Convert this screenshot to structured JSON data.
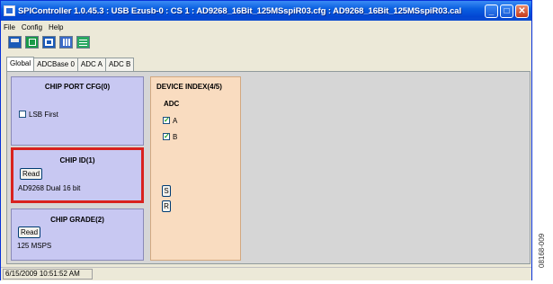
{
  "window": {
    "title": "SPIController 1.0.45.3 : USB Ezusb-0 : CS 1 : AD9268_16Bit_125MSspiR03.cfg : AD9268_16Bit_125MSspiR03.cal",
    "minimize_label": "_",
    "maximize_label": "□",
    "close_label": "✕"
  },
  "menu": {
    "items": [
      "File",
      "Config",
      "Help"
    ]
  },
  "toolbar": {
    "buttons": [
      "save-icon",
      "grid-icon",
      "table-icon",
      "chip-icon",
      "settings-icon"
    ]
  },
  "tabs": [
    "Global",
    "ADCBase 0",
    "ADC A",
    "ADC B"
  ],
  "chip_port_cfg": {
    "title": "CHIP PORT CFG(0)",
    "lsb_first_label": "LSB First",
    "lsb_first_checked": false
  },
  "chip_id": {
    "title": "CHIP ID(1)",
    "read_label": "Read",
    "value": "AD9268 Dual 16 bit"
  },
  "chip_grade": {
    "title": "CHIP GRADE(2)",
    "read_label": "Read",
    "value": "125 MSPS"
  },
  "device_index": {
    "title": "DEVICE INDEX(4/5)",
    "adc_label": "ADC",
    "channel_a_label": "A",
    "channel_a_checked": true,
    "channel_b_label": "B",
    "channel_b_checked": true,
    "s_label": "S",
    "r_label": "R"
  },
  "status": {
    "timestamp": "6/15/2009 10:51:52 AM"
  },
  "figure_id": "08168-009"
}
